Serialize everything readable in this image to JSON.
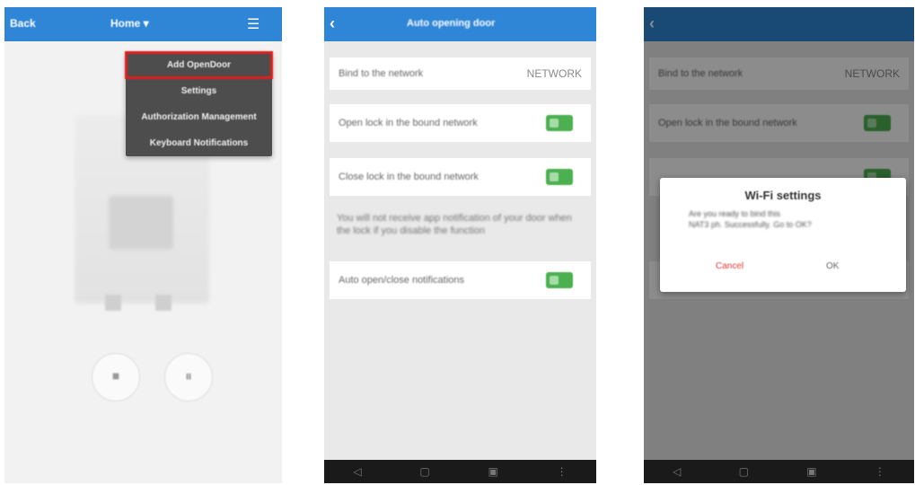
{
  "screen1": {
    "header": {
      "back_label": "Back",
      "title": "Home ▾",
      "menu_icon": "menu-icon"
    },
    "menu": {
      "items": [
        "Add OpenDoor",
        "Settings",
        "Authorization Management",
        "Keyboard Notifications"
      ],
      "highlighted_index": 0,
      "highlight_color": "#e0201e"
    },
    "controls": {
      "left_glyph": "⏹",
      "right_glyph": "⏸"
    }
  },
  "screen2": {
    "header": {
      "title": "Auto opening door"
    },
    "network_row": {
      "label": "Bind to the network",
      "value": "NETWORK"
    },
    "toggle1": {
      "label": "Open lock in the bound network",
      "on": true
    },
    "toggle2": {
      "label": "Close lock in the bound network",
      "on": true
    },
    "note": "You will not receive app notification of your door when the lock if you disable the function",
    "toggle3": {
      "label": "Auto open/close notifications",
      "on": true
    },
    "accent_color": "#4caf50"
  },
  "screen3": {
    "network_row": {
      "label": "Bind to the network",
      "value": "NETWORK"
    },
    "row2_label": "Open lock in the bound network",
    "dialog": {
      "title": "Wi-Fi settings",
      "message_line1": "Are you ready to bind this",
      "message_line2": "NAT3         ph. Successfully. Go to OK?",
      "cancel_label": "Cancel",
      "ok_label": "OK"
    }
  },
  "navbar": {
    "back": "◁",
    "home": "▢",
    "recent": "▣",
    "more": "⋮"
  },
  "colors": {
    "header_blue": "#2f86d6",
    "navbar": "#1a1a1a",
    "dialog_cancel": "#e53935"
  }
}
